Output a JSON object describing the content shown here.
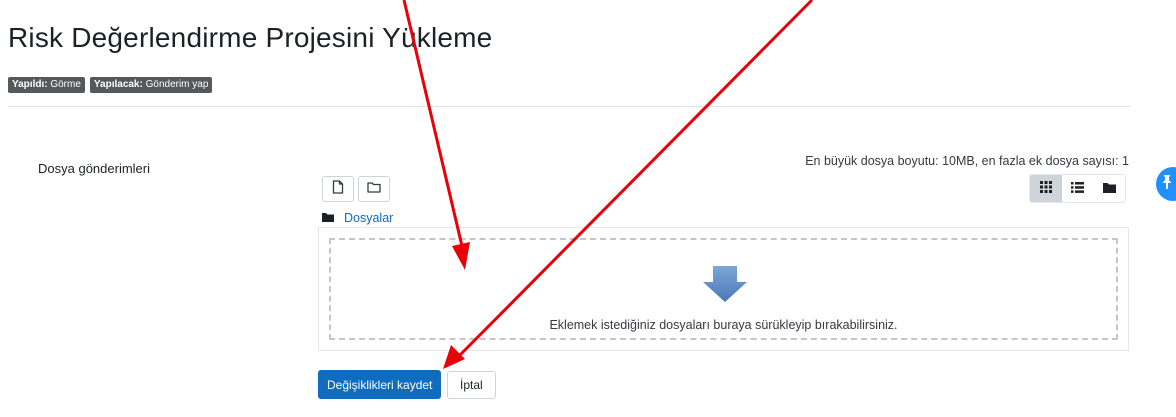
{
  "page": {
    "title": "Risk Değerlendirme Projesini Yükleme"
  },
  "badges": [
    {
      "key": "Yapıldı:",
      "value": "Görme"
    },
    {
      "key": "Yapılacak:",
      "value": "Gönderim yap"
    }
  ],
  "form": {
    "field_label": "Dosya gönderimleri",
    "max_info": "En büyük dosya boyutu: 10MB, en fazla ek dosya sayısı: 1",
    "toolbar": {
      "add_file_icon": "file-icon",
      "create_folder_icon": "folder-outline-icon"
    },
    "view_modes": [
      {
        "icon": "grid-icon",
        "active": true
      },
      {
        "icon": "list-icon",
        "active": false
      },
      {
        "icon": "folder-icon",
        "active": false
      }
    ],
    "folder_label": "Dosyalar",
    "drop_text": "Eklemek istediğiniz dosyaları buraya sürükleyip bırakabilirsiniz."
  },
  "actions": {
    "save_label": "Değişiklikleri kaydet",
    "cancel_label": "İptal"
  },
  "colors": {
    "primary": "#0f6cbf",
    "badge": "#55595c",
    "annotation_arrow": "#e8000b",
    "pin": "#1e90ff"
  }
}
